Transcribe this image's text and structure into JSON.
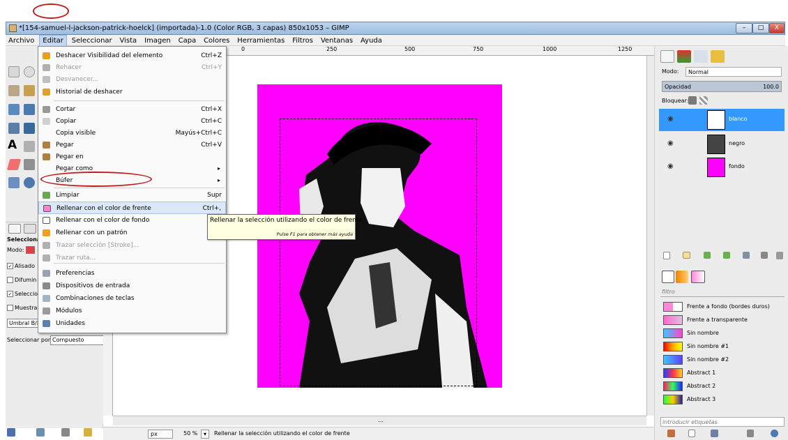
{
  "window": {
    "title": "*[154-samuel-l-jackson-patrick-hoelck] (importada)-1.0 (Color RGB, 3 capas) 850x1053 – GIMP",
    "min_label": "–",
    "max_label": "□",
    "close_label": "X"
  },
  "menubar": [
    "Archivo",
    "Editar",
    "Seleccionar",
    "Vista",
    "Imagen",
    "Capa",
    "Colores",
    "Herramientas",
    "Filtros",
    "Ventanas",
    "Ayuda"
  ],
  "edit_menu": {
    "items": [
      {
        "label": "Deshacer Visibilidad del elemento",
        "shortcut": "Ctrl+Z",
        "icon": "undo-icon",
        "color": "#e8a020"
      },
      {
        "label": "Rehacer",
        "shortcut": "Ctrl+Y",
        "icon": "redo-icon",
        "color": "#b0b0b0",
        "disabled": true
      },
      {
        "label": "Desvanecer...",
        "shortcut": "",
        "icon": "fade-icon",
        "color": "#c0c0c0",
        "disabled": true
      },
      {
        "label": "Historial de deshacer",
        "shortcut": "",
        "icon": "history-icon",
        "color": "#e0a030"
      },
      {
        "label": "Cortar",
        "shortcut": "Ctrl+X",
        "icon": "cut-icon",
        "color": "#999"
      },
      {
        "label": "Copiar",
        "shortcut": "Ctrl+C",
        "icon": "copy-icon",
        "color": "#cfcfcf"
      },
      {
        "label": "Copia visible",
        "shortcut": "Mayús+Ctrl+C",
        "icon": "",
        "color": ""
      },
      {
        "label": "Pegar",
        "shortcut": "Ctrl+V",
        "icon": "paste-icon",
        "color": "#b08040"
      },
      {
        "label": "Pegar en",
        "shortcut": "",
        "icon": "paste-into-icon",
        "color": "#b08040"
      },
      {
        "label": "Pegar como",
        "shortcut": "",
        "icon": "",
        "color": "",
        "submenu": true
      },
      {
        "label": "Búfer",
        "shortcut": "",
        "icon": "",
        "color": "",
        "submenu": true
      },
      {
        "label": "Limpiar",
        "shortcut": "Supr",
        "icon": "clear-icon",
        "color": "#6aa84f"
      },
      {
        "label": "Rellenar con el color de frente",
        "shortcut": "Ctrl+,",
        "icon": "fill-fg-icon",
        "color": "#ff80d0",
        "highlighted": true
      },
      {
        "label": "Rellenar con el color de fondo",
        "shortcut": "C",
        "icon": "fill-bg-icon",
        "color": "#ffffff"
      },
      {
        "label": "Rellenar con un patrón",
        "shortcut": "C",
        "icon": "fill-pattern-icon",
        "color": "#f0a020"
      },
      {
        "label": "Trazar selección [Stroke]...",
        "shortcut": "",
        "icon": "stroke-sel-icon",
        "color": "#b0b0b0",
        "disabled": true
      },
      {
        "label": "Trazar ruta...",
        "shortcut": "",
        "icon": "stroke-path-icon",
        "color": "#b0b0b0",
        "disabled": true
      },
      {
        "label": "Preferencias",
        "shortcut": "",
        "icon": "prefs-icon",
        "color": "#9aa4b0"
      },
      {
        "label": "Dispositivos de entrada",
        "shortcut": "",
        "icon": "input-dev-icon",
        "color": "#8a8a8a"
      },
      {
        "label": "Combinaciones de teclas",
        "shortcut": "",
        "icon": "keys-icon",
        "color": "#9fb4c8"
      },
      {
        "label": "Módulos",
        "shortcut": "",
        "icon": "modules-icon",
        "color": "#9a9a9a"
      },
      {
        "label": "Unidades",
        "shortcut": "",
        "icon": "units-icon",
        "color": "#5a7fb0"
      }
    ]
  },
  "tooltip": {
    "text": "Rellenar la selección utilizando el color de frente",
    "hint": "Pulse F1 para obtener más ayuda"
  },
  "ruler": [
    "0",
    "250",
    "500",
    "750",
    "1000",
    "1250"
  ],
  "tool_options": {
    "header": "Seleccionar",
    "mode_label": "Modo:",
    "antialias": "Alisado",
    "feather": "Difumin",
    "select_transparent": "Seleccio",
    "sample_merged": "Muestra",
    "threshold_label": "Umbral B/N",
    "select_by_label": "Seleccionar por:",
    "select_by_value": "Compuesto"
  },
  "status": {
    "unit": "px",
    "zoom": "50 %",
    "message": "Rellenar la selección utilizando el color de frente"
  },
  "layers_panel": {
    "mode_label": "Modo:",
    "mode_value": "Normal",
    "opacity_label": "Opacidad",
    "opacity_value": "100.0",
    "lock_label": "Bloquear:",
    "layers": [
      {
        "name": "blanco",
        "selected": true
      },
      {
        "name": "negro",
        "selected": false
      },
      {
        "name": "fondo",
        "selected": false
      }
    ]
  },
  "gradients_panel": {
    "filter_placeholder": "filtro",
    "tags_placeholder": "introducir etiquetas",
    "items": [
      {
        "name": "Frente a fondo (bordes duros)",
        "css": "linear-gradient(90deg,#ff88d8 50%,#fff 50%)"
      },
      {
        "name": "Frente a transparente",
        "css": "linear-gradient(90deg,#ff66cc,#e0c0e0)"
      },
      {
        "name": "Sin nombre",
        "css": "linear-gradient(90deg,#3fc6ff,#ff44cc)"
      },
      {
        "name": "Sin nombre #1",
        "css": "linear-gradient(90deg,#ff0000,#ffaa00,#ffff00)"
      },
      {
        "name": "Sin nombre #2",
        "css": "linear-gradient(90deg,#3fc6ff,#5a40ff)"
      },
      {
        "name": "Abstract 1",
        "css": "linear-gradient(90deg,#2040ff,#ff3050,#ffd020)"
      },
      {
        "name": "Abstract 2",
        "css": "linear-gradient(90deg,#ff2060,#30ff60,#2020ff)"
      },
      {
        "name": "Abstract 3",
        "css": "linear-gradient(90deg,#20ff40,#ffd000,#2020a0)"
      }
    ]
  },
  "colors": {
    "canvas_bg": "#ff00ff",
    "selected": "#3399ff",
    "annotation": "#c21d1d"
  }
}
